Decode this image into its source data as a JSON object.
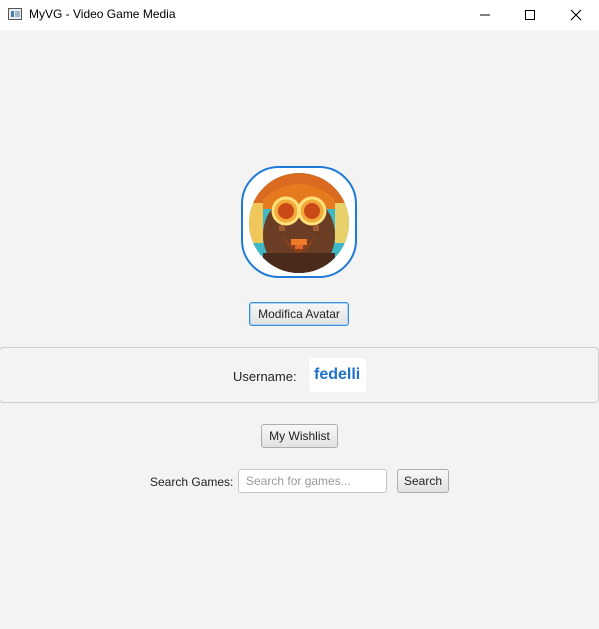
{
  "window": {
    "title": "MyVG - Video Game Media",
    "minimize_icon": "minimize-icon",
    "maximize_icon": "maximize-icon",
    "close_icon": "close-icon"
  },
  "profile": {
    "avatar_icon": "avatar-image",
    "avatar_button_label": "Modifica Avatar",
    "username_label": "Username:",
    "username_value": "fedelli",
    "username_color": "#1e72c8",
    "accent_color": "#1e7ad6"
  },
  "actions": {
    "wishlist_label": "My Wishlist"
  },
  "search": {
    "label": "Search Games:",
    "placeholder": "Search for games...",
    "value": "",
    "button_label": "Search"
  }
}
